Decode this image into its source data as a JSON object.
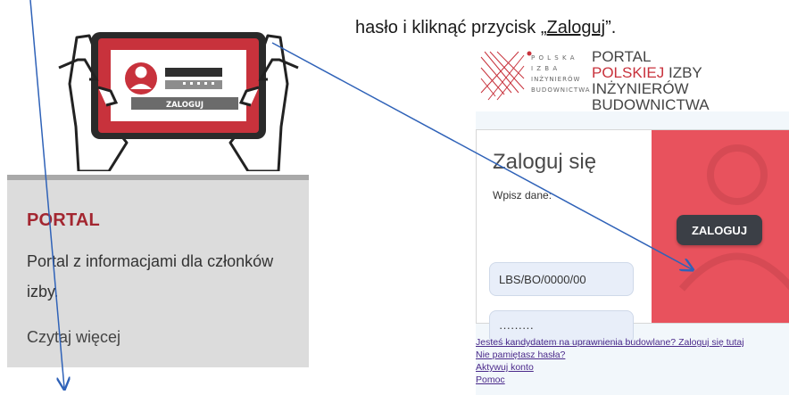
{
  "instruction": {
    "prefix": "hasło i kliknąć przycisk „",
    "button_word": "Zaloguj",
    "suffix": "”."
  },
  "illustration": {
    "button_label": "ZALOGUJ"
  },
  "card": {
    "title": "PORTAL",
    "description": "Portal z informacjami dla członków izby.",
    "read_more": "Czytaj więcej"
  },
  "portal": {
    "logo_text": [
      "P O L S K A",
      "I Z B A",
      "INŻYNIERÓW",
      "BUDOWNICTWA"
    ],
    "title_line1": "PORTAL",
    "title_line2_red": "POLSKIEJ",
    "title_line2_rest": " IZBY INŻYNIERÓW",
    "title_line3": "BUDOWNICTWA",
    "login_heading": "Zaloguj się",
    "login_sub": "Wpisz dane:",
    "login_value": "LBS/BO/0000/00",
    "password_value": "·········",
    "login_button": "ZALOGUJ",
    "links": [
      "Jesteś kandydatem na uprawnienia budowlane? Zaloguj się tutaj",
      "Nie pamiętasz hasła?",
      "Aktywuj konto",
      "Pomoc"
    ]
  },
  "colors": {
    "brand_red": "#c8323c",
    "login_panel": "#e8525d",
    "button_dark": "#3b3f46",
    "arrow": "#2f62b8"
  }
}
